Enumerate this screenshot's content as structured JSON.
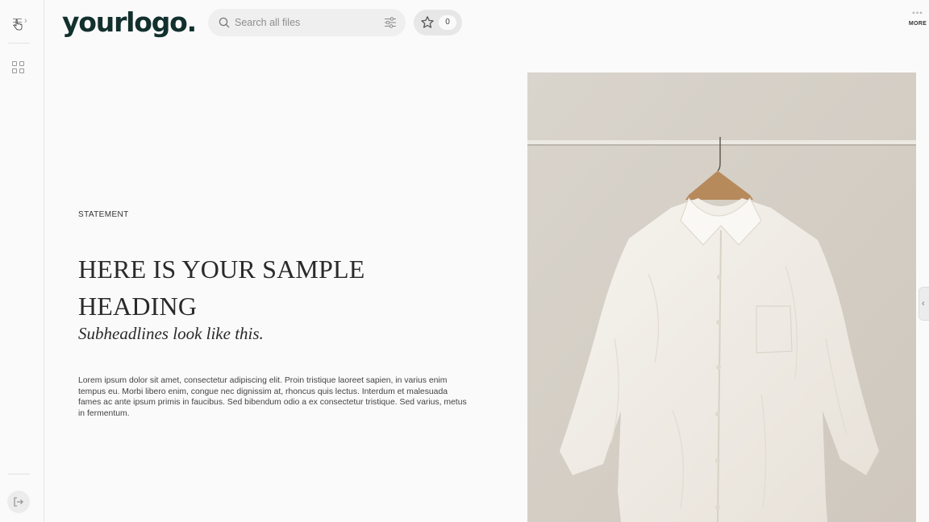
{
  "sidebar": {
    "menu_icon": "hamburger-menu-icon",
    "grid_icon": "grid-icon",
    "logout_icon": "logout-icon"
  },
  "header": {
    "logo_text": "yourlogo.",
    "search": {
      "placeholder": "Search all files",
      "value": ""
    },
    "favorites_count": "0",
    "more_label": "MORE",
    "more_icon": "ellipsis-icon"
  },
  "content": {
    "eyebrow": "STATEMENT",
    "heading": "HERE IS YOUR SAMPLE HEADING",
    "subheading": "Subheadlines look like this.",
    "body": "Lorem ipsum dolor sit amet, consectetur adipiscing elit. Proin tristique laoreet sapien, in varius enim tempus eu. Morbi libero enim, congue nec dignissim at, rhoncus quis lectus. Interdum et malesuada fames ac ante ipsum primis in faucibus. Sed bibendum odio a ex consectetur tristique. Sed varius, metus in fermentum."
  },
  "colors": {
    "logo": "#12302d",
    "background": "#fafafa",
    "photo_wall": "#d7d1c8",
    "shirt": "#f1ede6"
  }
}
